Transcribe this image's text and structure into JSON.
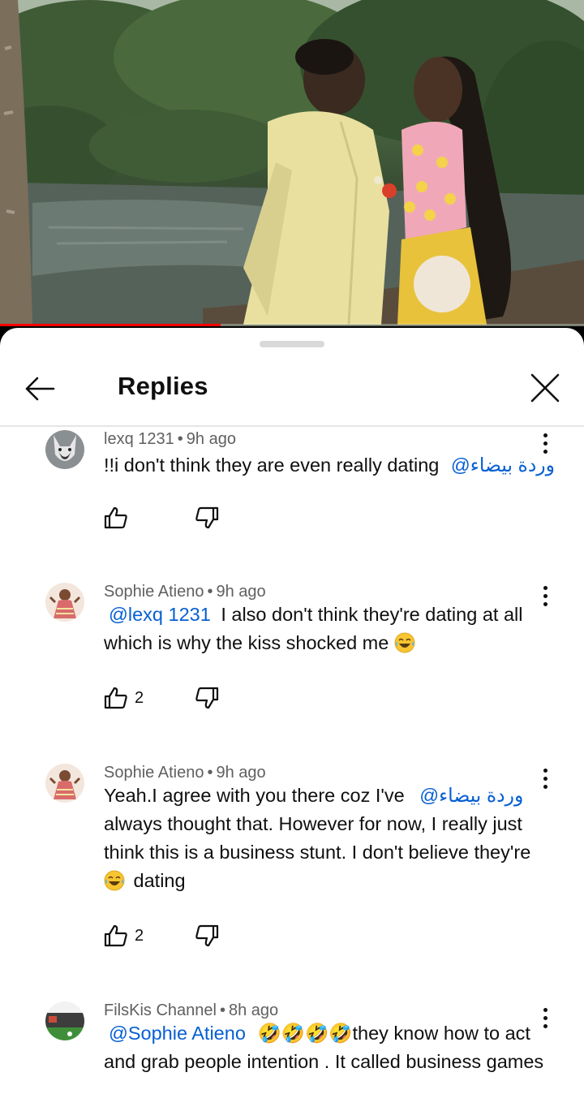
{
  "video": {
    "progress_fraction": 0.378
  },
  "sheet": {
    "title": "Replies"
  },
  "comments": [
    {
      "author": "lexq 1231",
      "time": "9h ago",
      "text": "!!i don't think they are even really dating",
      "mention": "@وردة بيضاء",
      "likes": ""
    },
    {
      "author": "Sophie Atieno",
      "time": "9h ago",
      "mention": "@lexq 1231",
      "text_line1": "I also don't think they're dating at all",
      "text_line2": "which is why the kiss shocked me",
      "emoji": "😂",
      "likes": "2"
    },
    {
      "author": "Sophie Atieno",
      "time": "9h ago",
      "text_line1": "Yeah.I agree with you there coz I've",
      "mention": "@وردة بيضاء",
      "text_line2": "always thought that. However for now,  I really just",
      "text_line3": "think this is a business stunt. I don't believe they're",
      "emoji": "😂",
      "text_line4": "dating",
      "likes": "2"
    },
    {
      "author": "FilsKis Channel",
      "time": "8h ago",
      "mention": "@Sophie Atieno",
      "emojis": "🤣🤣🤣🤣",
      "text_line1": "they know how to act",
      "text_line2": "and grab people intention . It called business games"
    }
  ],
  "separator": "•",
  "icons": {
    "back": "arrow-left-icon",
    "close": "close-icon",
    "more": "more-vertical-icon",
    "like": "thumbs-up-icon",
    "dislike": "thumbs-down-icon"
  },
  "colors": {
    "mention": "#065fd4",
    "progress": "#ff0000",
    "meta": "#606060"
  }
}
